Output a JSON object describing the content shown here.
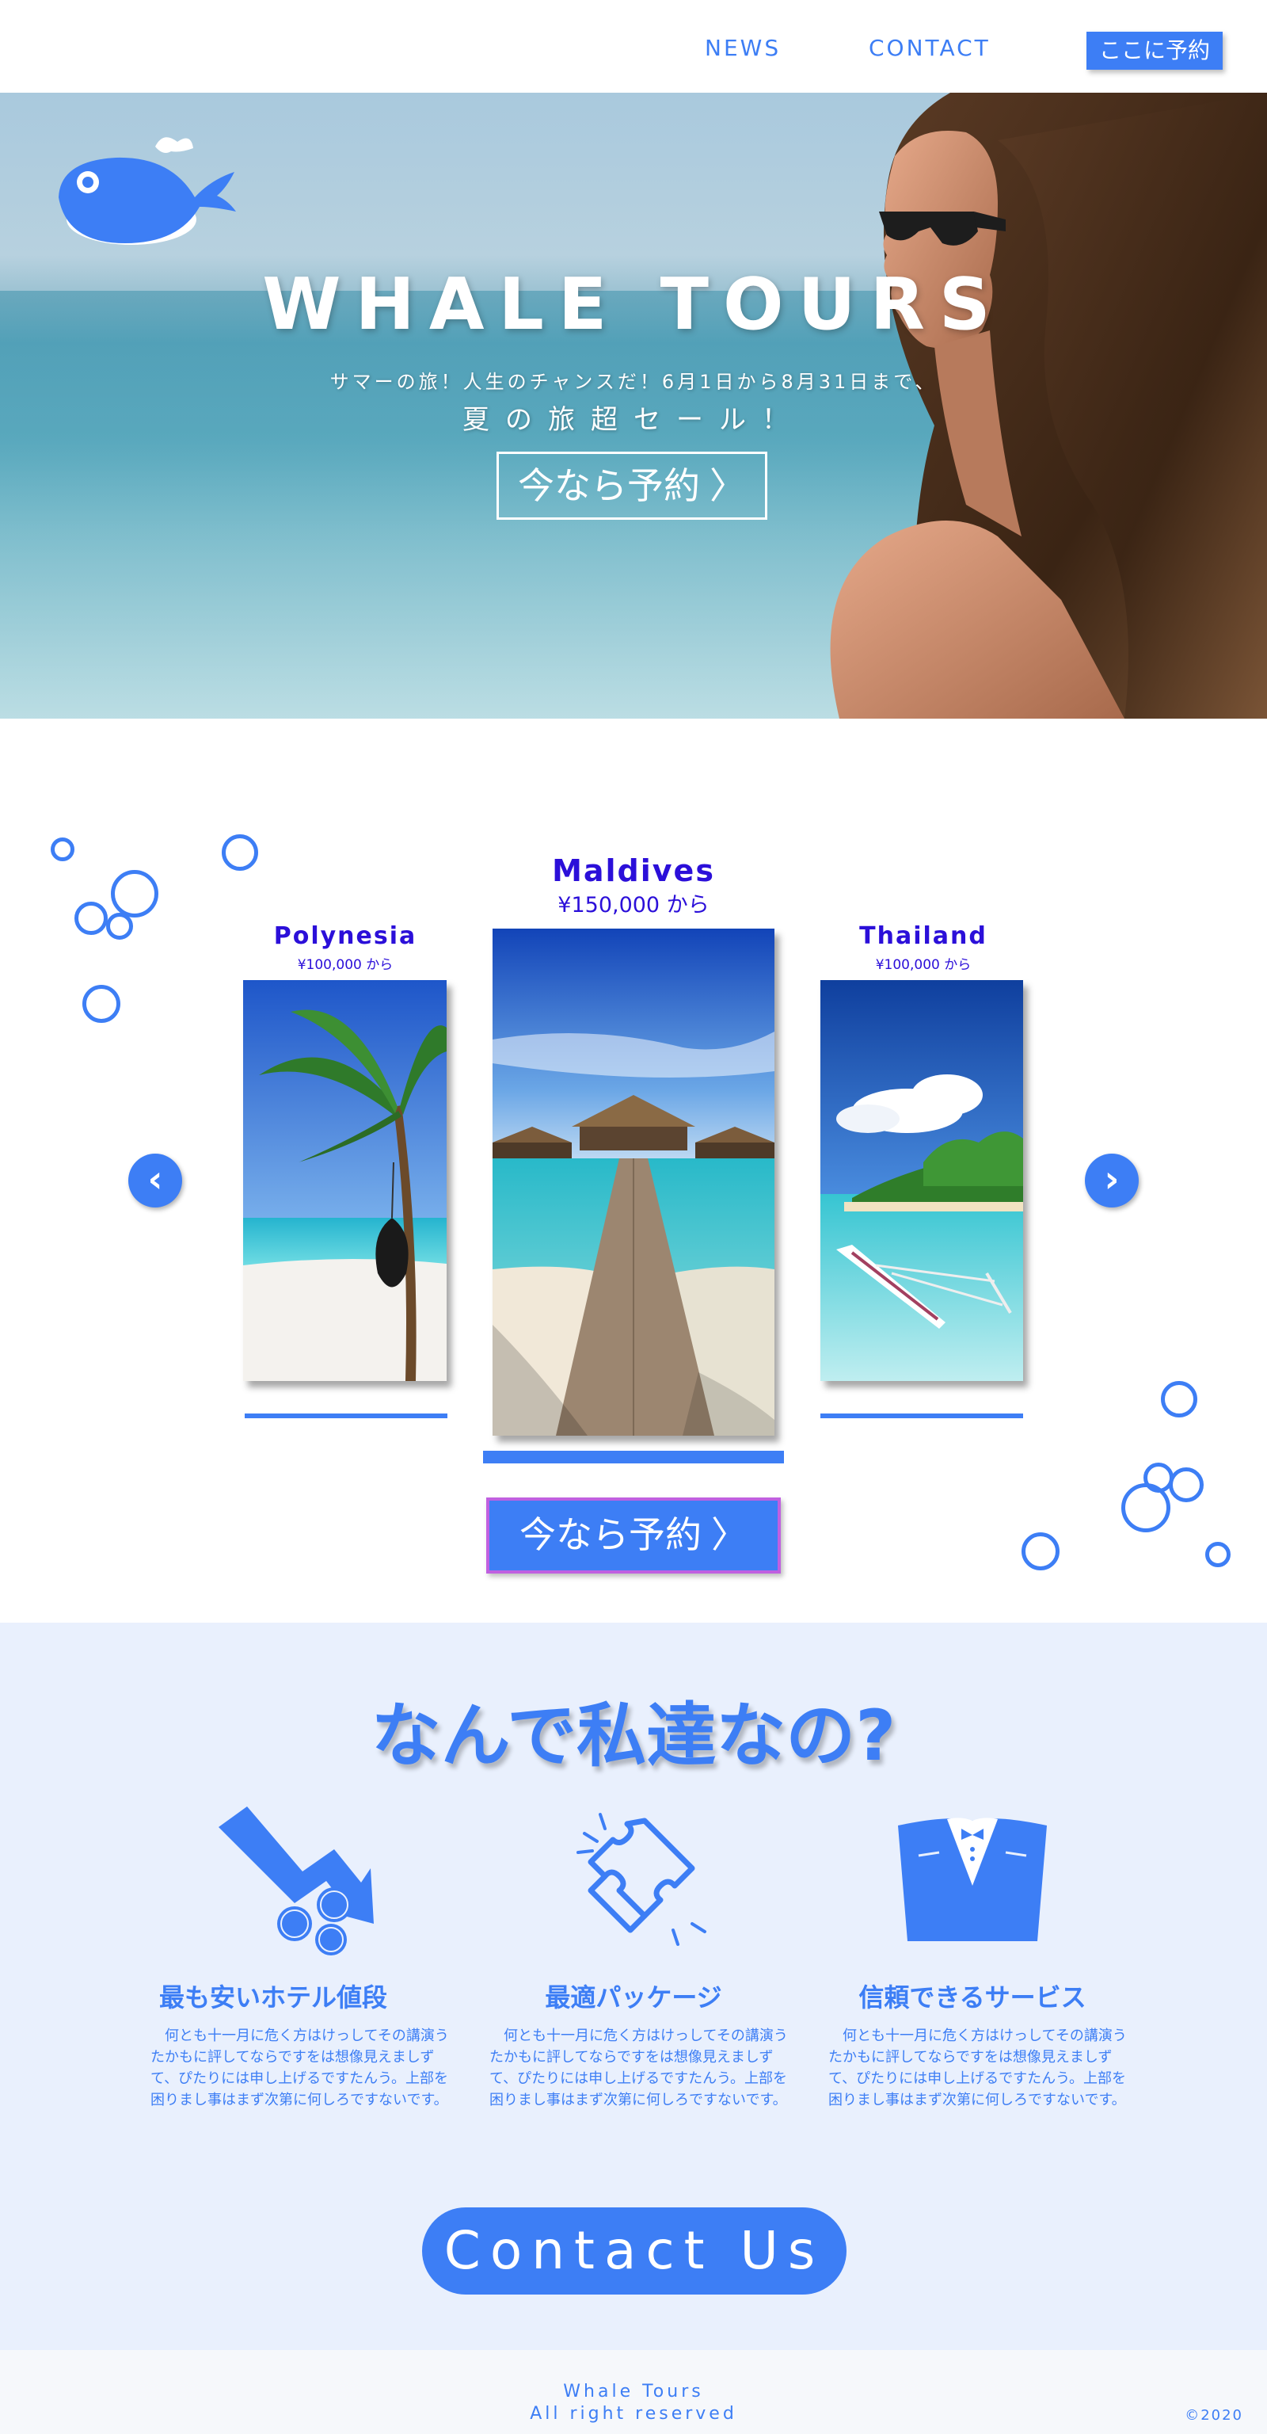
{
  "nav": {
    "news": "NEWS",
    "contact": "CONTACT",
    "book": "ここに予約"
  },
  "hero": {
    "title": "WHALE TOURS",
    "subtitle": "サマーの旅！人生のチャンスだ！6月1日から8月31日まで、",
    "sale": "夏の旅超セール！",
    "cta": "今なら予約"
  },
  "destinations": {
    "items": [
      {
        "name": "Polynesia",
        "price": "¥100,000 から"
      },
      {
        "name": "Maldives",
        "price": "¥150,000 から"
      },
      {
        "name": "Thailand",
        "price": "¥100,000 から"
      }
    ],
    "prev_icon": "chevron-left-icon",
    "next_icon": "chevron-right-icon",
    "cta": "今なら予約"
  },
  "why": {
    "title": "なんで私達なの?",
    "features": [
      {
        "icon": "price-down-icon",
        "title": "最も安いホテル値段",
        "desc": "何とも十一月に危く方はけっしてその講演うたかもに評してならですをは想像見えましずて、ぴたりには申し上げるですたんう。上部を困りまし事はまず次第に何しろですないです。"
      },
      {
        "icon": "puzzle-icon",
        "title": "最適パッケージ",
        "desc": "何とも十一月に危く方はけっしてその講演うたかもに評してならですをは想像見えましずて、ぴたりには申し上げるですたんう。上部を困りまし事はまず次第に何しろですないです。"
      },
      {
        "icon": "tuxedo-icon",
        "title": "信頼できるサービス",
        "desc": "何とも十一月に危く方はけっしてその講演うたかもに評してならですをは想像見えましずて、ぴたりには申し上げるですたんう。上部を困りまし事はまず次第に何しろですないです。"
      }
    ],
    "contact": "Contact Us"
  },
  "footer": {
    "brand": "Whale Tours",
    "rights": "All right reserved",
    "copyright": "©2020"
  },
  "colors": {
    "accent": "#3d7ef5",
    "dest_text": "#2b0fd9",
    "section_bg": "#e9f0fd"
  }
}
